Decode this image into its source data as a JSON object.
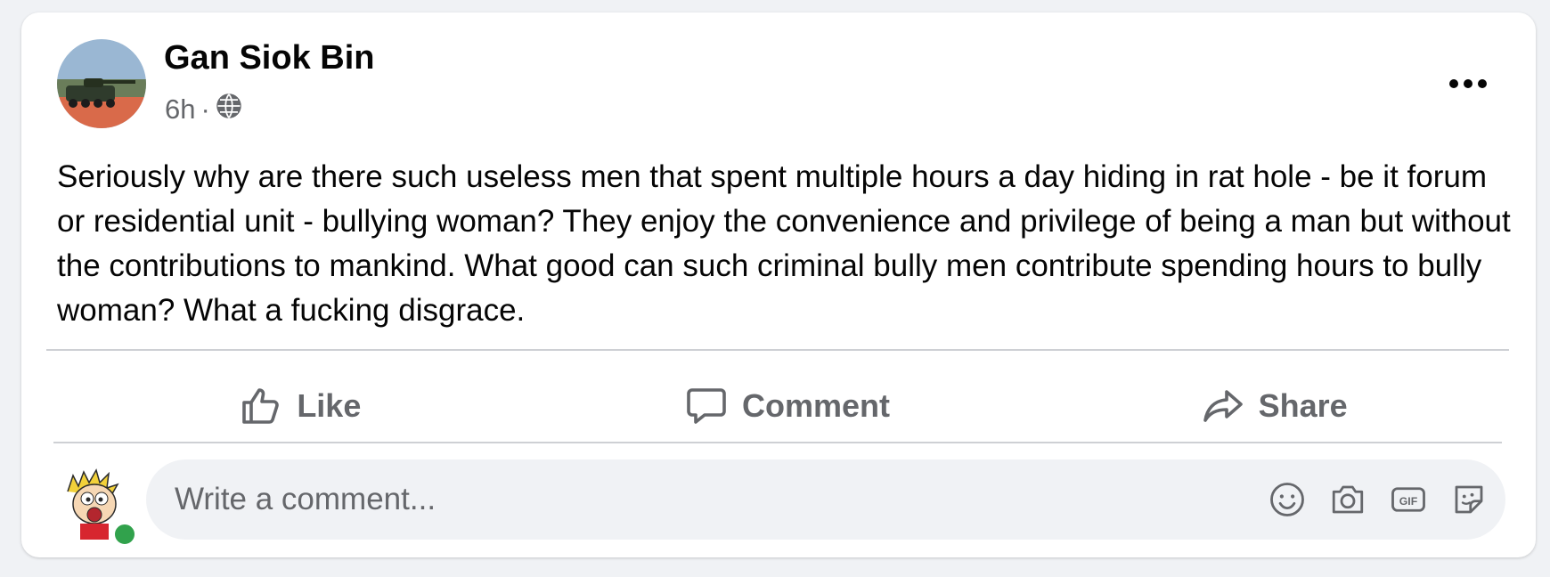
{
  "post": {
    "author": "Gan Siok Bin",
    "time": "6h",
    "separator": "·",
    "privacy_icon": "globe-icon",
    "text": "Seriously why are there such useless men that spent multiple hours a day hiding in rat hole - be it forum or residential unit - bullying woman? They enjoy the convenience and privilege of being a man but without the contributions to mankind. What good can such criminal bully men contribute spending hours to bully woman? What a fucking disgrace."
  },
  "actions": {
    "like": "Like",
    "comment": "Comment",
    "share": "Share"
  },
  "comment_input": {
    "placeholder": "Write a comment...",
    "icons": [
      "emoji-icon",
      "camera-icon",
      "gif-icon",
      "sticker-icon"
    ]
  },
  "colors": {
    "text_primary": "#050505",
    "text_secondary": "#65676b",
    "divider": "#ced0d4",
    "online": "#31a24c",
    "input_bg": "#f0f2f5"
  }
}
